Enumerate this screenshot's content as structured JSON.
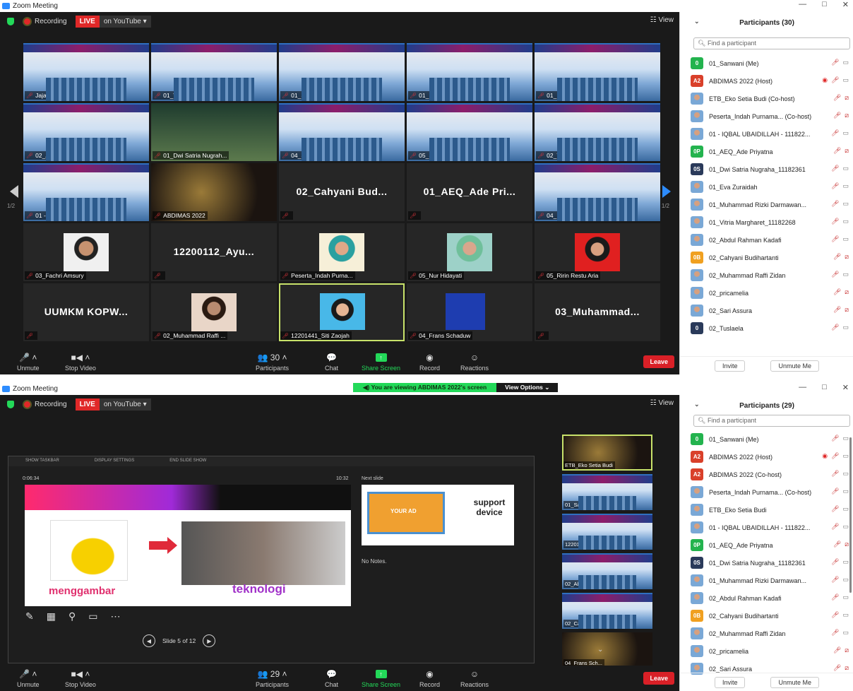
{
  "w1": {
    "title": "Zoom Meeting",
    "recording": "Recording",
    "live": "LIVE",
    "youtube": "on YouTube",
    "view": "View",
    "page_left": "1/2",
    "page_right": "1/2",
    "tiles": [
      {
        "name": "Jajang Abdul Jabb...",
        "style": "banner"
      },
      {
        "name": "01_Vitria Margharet...",
        "style": "banner"
      },
      {
        "name": "01_Sanwani",
        "style": "banner"
      },
      {
        "name": "01_Eva Zuraidah",
        "style": "banner"
      },
      {
        "name": "01_Muhammad Rizki ...",
        "style": "banner"
      },
      {
        "name": "02_Abdul Rahman Ka...",
        "style": "banner"
      },
      {
        "name": "01_Dwi Satria Nugrah...",
        "style": "green"
      },
      {
        "name": "04_Sunarti",
        "style": "banner"
      },
      {
        "name": "05_Susliansyah",
        "style": "banner"
      },
      {
        "name": "02_Tuslaela",
        "style": "banner"
      },
      {
        "name": "01 - IQBAL UBAIDILLA...",
        "style": "banner"
      },
      {
        "name": "ABDIMAS 2022",
        "style": "dark"
      },
      {
        "name": "",
        "style": "text",
        "big": "02_Cahyani Bud..."
      },
      {
        "name": "",
        "style": "text",
        "big": "01_AEQ_Ade Pri..."
      },
      {
        "name": "04_Resti Lia Andharsa...",
        "style": "banner"
      },
      {
        "name": "03_Fachri Amsury",
        "style": "pic",
        "pic": "w"
      },
      {
        "name": "",
        "style": "text",
        "big": "12200112_Ayu..."
      },
      {
        "name": "Peserta_Indah Purna...",
        "style": "pic",
        "pic": "hj"
      },
      {
        "name": "05_Nur Hidayati",
        "style": "pic",
        "pic": "hj2"
      },
      {
        "name": "05_Ririn Restu Aria",
        "style": "pic",
        "pic": "red"
      },
      {
        "name": "",
        "style": "text",
        "big": "UUMKM KOPW..."
      },
      {
        "name": "02_Muhammad Raffi ...",
        "style": "pic",
        "pic": "guy"
      },
      {
        "name": "12201441_Siti Zaojah",
        "style": "pic",
        "pic": "sel"
      },
      {
        "name": "04_Frans Schaduw",
        "style": "blue"
      },
      {
        "name": "",
        "style": "text",
        "big": "03_Muhammad..."
      }
    ],
    "toolbar": {
      "unmute": "Unmute",
      "stop_video": "Stop Video",
      "participants": "Participants",
      "count": "30",
      "chat": "Chat",
      "share": "Share Screen",
      "record": "Record",
      "reactions": "Reactions",
      "leave": "Leave"
    },
    "panel": {
      "title": "Participants (30)",
      "find": "Find a participant",
      "invite": "Invite",
      "unmute_me": "Unmute Me",
      "rows": [
        {
          "av": "0",
          "color": "#23b34e",
          "name": "01_Sanwani (Me)",
          "cam": "on"
        },
        {
          "av": "A2",
          "color": "#d9402a",
          "name": "ABDIMAS 2022 (Host)",
          "cam": "on",
          "rec": true
        },
        {
          "av": "",
          "color": "",
          "name": "ETB_Eko Setia Budi (Co-host)",
          "cam": "off"
        },
        {
          "av": "",
          "color": "",
          "name": "Peserta_Indah Purnama... (Co-host)",
          "cam": "off"
        },
        {
          "av": "",
          "color": "",
          "name": "01 - IQBAL UBAIDILLAH - 111822...",
          "cam": "on"
        },
        {
          "av": "0P",
          "color": "#23b34e",
          "name": "01_AEQ_Ade Priyatna",
          "cam": "off"
        },
        {
          "av": "0S",
          "color": "#2a3a5a",
          "name": "01_Dwi Satria Nugraha_11182361",
          "cam": "on"
        },
        {
          "av": "",
          "color": "",
          "name": "01_Eva Zuraidah",
          "cam": "on"
        },
        {
          "av": "",
          "color": "",
          "name": "01_Muhammad Rizki Darmawan...",
          "cam": "on"
        },
        {
          "av": "",
          "color": "",
          "name": "01_Vitria Margharet_11182268",
          "cam": "on"
        },
        {
          "av": "",
          "color": "",
          "name": "02_Abdul Rahman Kadafi",
          "cam": "on"
        },
        {
          "av": "0B",
          "color": "#f0a020",
          "name": "02_Cahyani Budihartanti",
          "cam": "off"
        },
        {
          "av": "",
          "color": "",
          "name": "02_Muhammad Raffi Zidan",
          "cam": "on"
        },
        {
          "av": "",
          "color": "",
          "name": "02_pricamelia",
          "cam": "off"
        },
        {
          "av": "",
          "color": "",
          "name": "02_Sari Assura",
          "cam": "off"
        },
        {
          "av": "0",
          "color": "#2a3a5a",
          "name": "02_Tuslaela",
          "cam": "on"
        }
      ]
    }
  },
  "w2": {
    "title": "Zoom Meeting",
    "viewing": "You are viewing ABDIMAS 2022's screen",
    "view_options": "View Options",
    "recording": "Recording",
    "live": "LIVE",
    "youtube": "on YouTube",
    "view": "View",
    "slide": {
      "show_taskbar": "SHOW TASKBAR",
      "display_settings": "DISPLAY SETTINGS",
      "end_show": "END SLIDE SHOW",
      "elapsed": "0:06:34",
      "clock": "10:32",
      "next_slide": "Next slide",
      "word1": "menggambar",
      "word2": "teknologi",
      "next_text": "support device",
      "your_ad": "YOUR AD",
      "no_notes": "No Notes.",
      "position": "Slide 5 of 12"
    },
    "thumbs": [
      {
        "name": "ETB_Eko Setia Budi",
        "style": "photo"
      },
      {
        "name": "01_Sanwani",
        "style": "banner"
      },
      {
        "name": "12201441_Sit...",
        "style": "banner"
      },
      {
        "name": "02_Abdul Rah...",
        "style": "banner"
      },
      {
        "name": "02_Cahyani B...",
        "style": "banner"
      },
      {
        "name": "04_Frans Sch...",
        "style": "photo"
      }
    ],
    "toolbar": {
      "unmute": "Unmute",
      "stop_video": "Stop Video",
      "participants": "Participants",
      "count": "29",
      "chat": "Chat",
      "share": "Share Screen",
      "record": "Record",
      "reactions": "Reactions",
      "leave": "Leave"
    },
    "panel": {
      "title": "Participants (29)",
      "find": "Find a participant",
      "invite": "Invite",
      "unmute_me": "Unmute Me",
      "rows": [
        {
          "av": "0",
          "color": "#23b34e",
          "name": "01_Sanwani (Me)",
          "cam": "on"
        },
        {
          "av": "A2",
          "color": "#d9402a",
          "name": "ABDIMAS 2022 (Host)",
          "cam": "on",
          "rec": true
        },
        {
          "av": "A2",
          "color": "#d9402a",
          "name": "ABDIMAS 2022 (Co-host)",
          "cam": "on"
        },
        {
          "av": "",
          "color": "",
          "name": "Peserta_Indah Purnama... (Co-host)",
          "cam": "on"
        },
        {
          "av": "",
          "color": "",
          "name": "ETB_Eko Setia Budi",
          "cam": "on"
        },
        {
          "av": "",
          "color": "",
          "name": "01 - IQBAL UBAIDILLAH - 111822...",
          "cam": "on"
        },
        {
          "av": "0P",
          "color": "#23b34e",
          "name": "01_AEQ_Ade Priyatna",
          "cam": "off"
        },
        {
          "av": "0S",
          "color": "#2a3a5a",
          "name": "01_Dwi Satria Nugraha_11182361",
          "cam": "on"
        },
        {
          "av": "",
          "color": "",
          "name": "01_Muhammad Rizki Darmawan...",
          "cam": "on"
        },
        {
          "av": "",
          "color": "",
          "name": "02_Abdul Rahman Kadafi",
          "cam": "on"
        },
        {
          "av": "0B",
          "color": "#f0a020",
          "name": "02_Cahyani Budihartanti",
          "cam": "on"
        },
        {
          "av": "",
          "color": "",
          "name": "02_Muhammad Raffi Zidan",
          "cam": "on"
        },
        {
          "av": "",
          "color": "",
          "name": "02_pricamelia",
          "cam": "off"
        },
        {
          "av": "",
          "color": "",
          "name": "02_Sari Assura",
          "cam": "off"
        },
        {
          "av": "0",
          "color": "#2a3a5a",
          "name": "02_Tuslaela",
          "cam": "on"
        },
        {
          "av": "",
          "color": "",
          "name": "03_Fachri Amsury",
          "cam": "off"
        }
      ]
    }
  }
}
